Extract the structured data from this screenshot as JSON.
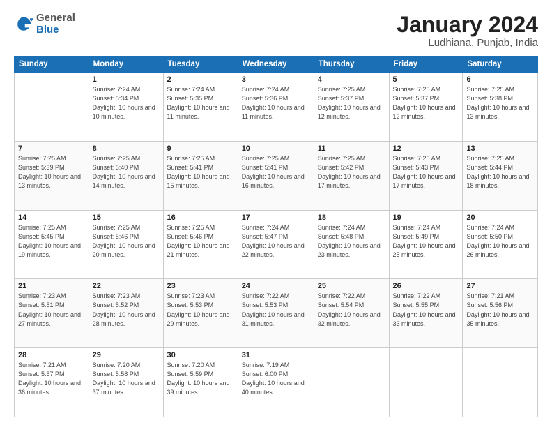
{
  "header": {
    "logo_general": "General",
    "logo_blue": "Blue",
    "month_title": "January 2024",
    "location": "Ludhiana, Punjab, India"
  },
  "days_of_week": [
    "Sunday",
    "Monday",
    "Tuesday",
    "Wednesday",
    "Thursday",
    "Friday",
    "Saturday"
  ],
  "weeks": [
    [
      {
        "day": "",
        "sunrise": "",
        "sunset": "",
        "daylight": ""
      },
      {
        "day": "1",
        "sunrise": "Sunrise: 7:24 AM",
        "sunset": "Sunset: 5:34 PM",
        "daylight": "Daylight: 10 hours and 10 minutes."
      },
      {
        "day": "2",
        "sunrise": "Sunrise: 7:24 AM",
        "sunset": "Sunset: 5:35 PM",
        "daylight": "Daylight: 10 hours and 11 minutes."
      },
      {
        "day": "3",
        "sunrise": "Sunrise: 7:24 AM",
        "sunset": "Sunset: 5:36 PM",
        "daylight": "Daylight: 10 hours and 11 minutes."
      },
      {
        "day": "4",
        "sunrise": "Sunrise: 7:25 AM",
        "sunset": "Sunset: 5:37 PM",
        "daylight": "Daylight: 10 hours and 12 minutes."
      },
      {
        "day": "5",
        "sunrise": "Sunrise: 7:25 AM",
        "sunset": "Sunset: 5:37 PM",
        "daylight": "Daylight: 10 hours and 12 minutes."
      },
      {
        "day": "6",
        "sunrise": "Sunrise: 7:25 AM",
        "sunset": "Sunset: 5:38 PM",
        "daylight": "Daylight: 10 hours and 13 minutes."
      }
    ],
    [
      {
        "day": "7",
        "sunrise": "Sunrise: 7:25 AM",
        "sunset": "Sunset: 5:39 PM",
        "daylight": "Daylight: 10 hours and 13 minutes."
      },
      {
        "day": "8",
        "sunrise": "Sunrise: 7:25 AM",
        "sunset": "Sunset: 5:40 PM",
        "daylight": "Daylight: 10 hours and 14 minutes."
      },
      {
        "day": "9",
        "sunrise": "Sunrise: 7:25 AM",
        "sunset": "Sunset: 5:41 PM",
        "daylight": "Daylight: 10 hours and 15 minutes."
      },
      {
        "day": "10",
        "sunrise": "Sunrise: 7:25 AM",
        "sunset": "Sunset: 5:41 PM",
        "daylight": "Daylight: 10 hours and 16 minutes."
      },
      {
        "day": "11",
        "sunrise": "Sunrise: 7:25 AM",
        "sunset": "Sunset: 5:42 PM",
        "daylight": "Daylight: 10 hours and 17 minutes."
      },
      {
        "day": "12",
        "sunrise": "Sunrise: 7:25 AM",
        "sunset": "Sunset: 5:43 PM",
        "daylight": "Daylight: 10 hours and 17 minutes."
      },
      {
        "day": "13",
        "sunrise": "Sunrise: 7:25 AM",
        "sunset": "Sunset: 5:44 PM",
        "daylight": "Daylight: 10 hours and 18 minutes."
      }
    ],
    [
      {
        "day": "14",
        "sunrise": "Sunrise: 7:25 AM",
        "sunset": "Sunset: 5:45 PM",
        "daylight": "Daylight: 10 hours and 19 minutes."
      },
      {
        "day": "15",
        "sunrise": "Sunrise: 7:25 AM",
        "sunset": "Sunset: 5:46 PM",
        "daylight": "Daylight: 10 hours and 20 minutes."
      },
      {
        "day": "16",
        "sunrise": "Sunrise: 7:25 AM",
        "sunset": "Sunset: 5:46 PM",
        "daylight": "Daylight: 10 hours and 21 minutes."
      },
      {
        "day": "17",
        "sunrise": "Sunrise: 7:24 AM",
        "sunset": "Sunset: 5:47 PM",
        "daylight": "Daylight: 10 hours and 22 minutes."
      },
      {
        "day": "18",
        "sunrise": "Sunrise: 7:24 AM",
        "sunset": "Sunset: 5:48 PM",
        "daylight": "Daylight: 10 hours and 23 minutes."
      },
      {
        "day": "19",
        "sunrise": "Sunrise: 7:24 AM",
        "sunset": "Sunset: 5:49 PM",
        "daylight": "Daylight: 10 hours and 25 minutes."
      },
      {
        "day": "20",
        "sunrise": "Sunrise: 7:24 AM",
        "sunset": "Sunset: 5:50 PM",
        "daylight": "Daylight: 10 hours and 26 minutes."
      }
    ],
    [
      {
        "day": "21",
        "sunrise": "Sunrise: 7:23 AM",
        "sunset": "Sunset: 5:51 PM",
        "daylight": "Daylight: 10 hours and 27 minutes."
      },
      {
        "day": "22",
        "sunrise": "Sunrise: 7:23 AM",
        "sunset": "Sunset: 5:52 PM",
        "daylight": "Daylight: 10 hours and 28 minutes."
      },
      {
        "day": "23",
        "sunrise": "Sunrise: 7:23 AM",
        "sunset": "Sunset: 5:53 PM",
        "daylight": "Daylight: 10 hours and 29 minutes."
      },
      {
        "day": "24",
        "sunrise": "Sunrise: 7:22 AM",
        "sunset": "Sunset: 5:53 PM",
        "daylight": "Daylight: 10 hours and 31 minutes."
      },
      {
        "day": "25",
        "sunrise": "Sunrise: 7:22 AM",
        "sunset": "Sunset: 5:54 PM",
        "daylight": "Daylight: 10 hours and 32 minutes."
      },
      {
        "day": "26",
        "sunrise": "Sunrise: 7:22 AM",
        "sunset": "Sunset: 5:55 PM",
        "daylight": "Daylight: 10 hours and 33 minutes."
      },
      {
        "day": "27",
        "sunrise": "Sunrise: 7:21 AM",
        "sunset": "Sunset: 5:56 PM",
        "daylight": "Daylight: 10 hours and 35 minutes."
      }
    ],
    [
      {
        "day": "28",
        "sunrise": "Sunrise: 7:21 AM",
        "sunset": "Sunset: 5:57 PM",
        "daylight": "Daylight: 10 hours and 36 minutes."
      },
      {
        "day": "29",
        "sunrise": "Sunrise: 7:20 AM",
        "sunset": "Sunset: 5:58 PM",
        "daylight": "Daylight: 10 hours and 37 minutes."
      },
      {
        "day": "30",
        "sunrise": "Sunrise: 7:20 AM",
        "sunset": "Sunset: 5:59 PM",
        "daylight": "Daylight: 10 hours and 39 minutes."
      },
      {
        "day": "31",
        "sunrise": "Sunrise: 7:19 AM",
        "sunset": "Sunset: 6:00 PM",
        "daylight": "Daylight: 10 hours and 40 minutes."
      },
      {
        "day": "",
        "sunrise": "",
        "sunset": "",
        "daylight": ""
      },
      {
        "day": "",
        "sunrise": "",
        "sunset": "",
        "daylight": ""
      },
      {
        "day": "",
        "sunrise": "",
        "sunset": "",
        "daylight": ""
      }
    ]
  ]
}
